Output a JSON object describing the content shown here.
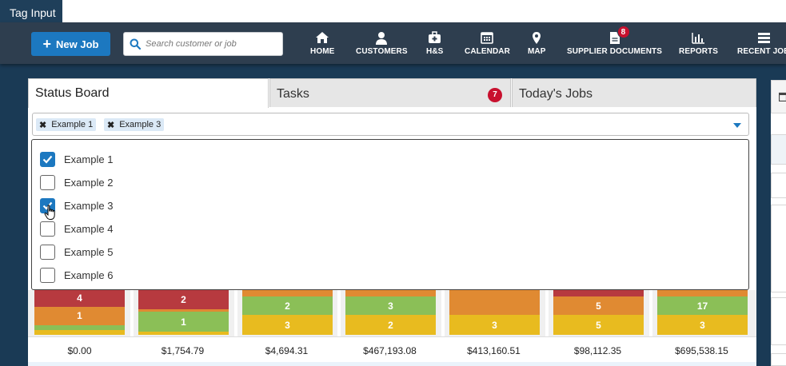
{
  "window": {
    "title": "Tag Input"
  },
  "nav": {
    "new_job_label": "New Job",
    "search_placeholder": "Search customer or job",
    "items": [
      {
        "label": "HOME",
        "icon": "home-icon"
      },
      {
        "label": "CUSTOMERS",
        "icon": "user-icon"
      },
      {
        "label": "H&S",
        "icon": "first-aid-icon"
      },
      {
        "label": "CALENDAR",
        "icon": "calendar-icon"
      },
      {
        "label": "MAP",
        "icon": "map-pin-icon"
      },
      {
        "label": "SUPPLIER DOCUMENTS",
        "icon": "document-icon",
        "badge": "8"
      },
      {
        "label": "REPORTS",
        "icon": "bar-chart-icon"
      },
      {
        "label": "RECENT JOBS",
        "icon": "list-icon"
      }
    ]
  },
  "tabs": [
    {
      "label": "Status Board",
      "active": true
    },
    {
      "label": "Tasks",
      "badge": "7"
    },
    {
      "label": "Today's Jobs"
    }
  ],
  "tag_input": {
    "tags": [
      "Example 1",
      "Example 3"
    ],
    "options": [
      {
        "label": "Example 1",
        "checked": true
      },
      {
        "label": "Example 2",
        "checked": false
      },
      {
        "label": "Example 3",
        "checked": true
      },
      {
        "label": "Example 4",
        "checked": false
      },
      {
        "label": "Example 5",
        "checked": false
      },
      {
        "label": "Example 6",
        "checked": false
      }
    ]
  },
  "status_board": {
    "colors": {
      "red": "#b73a3f",
      "orange": "#e08a32",
      "green": "#8bbf57",
      "yellow": "#e8bb1f"
    },
    "columns": [
      {
        "total": "$0.00",
        "segments": [
          {
            "color": "red",
            "label": "4",
            "share": 0.38
          },
          {
            "color": "orange",
            "label": "1",
            "share": 0.42
          },
          {
            "color": "green",
            "label": "",
            "share": 0.1
          },
          {
            "color": "yellow",
            "label": "",
            "share": 0.1
          }
        ]
      },
      {
        "total": "$1,754.79",
        "segments": [
          {
            "color": "red",
            "label": "2",
            "share": 0.42
          },
          {
            "color": "orange",
            "label": "",
            "share": 0.06
          },
          {
            "color": "green",
            "label": "1",
            "share": 0.44
          },
          {
            "color": "yellow",
            "label": "",
            "share": 0.08
          }
        ]
      },
      {
        "total": "$4,694.31",
        "segments": [
          {
            "color": "orange",
            "label": "",
            "share": 0.14
          },
          {
            "color": "green",
            "label": "2",
            "share": 0.42
          },
          {
            "color": "yellow",
            "label": "3",
            "share": 0.44
          }
        ]
      },
      {
        "total": "$467,193.08",
        "segments": [
          {
            "color": "orange",
            "label": "",
            "share": 0.14
          },
          {
            "color": "green",
            "label": "3",
            "share": 0.42
          },
          {
            "color": "yellow",
            "label": "2",
            "share": 0.44
          }
        ]
      },
      {
        "total": "$413,160.51",
        "segments": [
          {
            "color": "orange",
            "label": "",
            "share": 0.56
          },
          {
            "color": "yellow",
            "label": "3",
            "share": 0.44
          }
        ]
      },
      {
        "total": "$98,112.35",
        "segments": [
          {
            "color": "red",
            "label": "",
            "share": 0.14
          },
          {
            "color": "orange",
            "label": "5",
            "share": 0.42
          },
          {
            "color": "yellow",
            "label": "5",
            "share": 0.44
          }
        ]
      },
      {
        "total": "$695,538.15",
        "segments": [
          {
            "color": "orange",
            "label": "",
            "share": 0.14
          },
          {
            "color": "green",
            "label": "17",
            "share": 0.42
          },
          {
            "color": "yellow",
            "label": "3",
            "share": 0.44
          }
        ]
      }
    ]
  }
}
